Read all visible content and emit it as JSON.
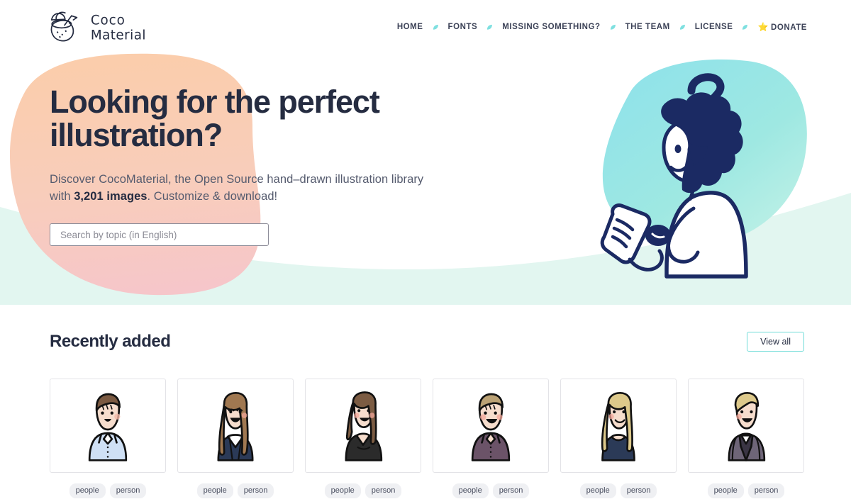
{
  "brand": {
    "name": "Coco Material",
    "line1": "Coco",
    "line2": "Material",
    "logo_icon": "coconut-drink-icon"
  },
  "nav": {
    "separator_icon": "leaf-dot-separator-icon",
    "items": [
      {
        "label": "HOME",
        "name": "nav-home"
      },
      {
        "label": "FONTS",
        "name": "nav-fonts"
      },
      {
        "label": "MISSING SOMETHING?",
        "name": "nav-missing-something"
      },
      {
        "label": "THE TEAM",
        "name": "nav-the-team"
      },
      {
        "label": "LICENSE",
        "name": "nav-license"
      },
      {
        "label": "DONATE",
        "name": "nav-donate",
        "icon": "star-icon",
        "icon_glyph": "⭐"
      }
    ]
  },
  "hero": {
    "title_line1": "Looking for the perfect",
    "title_line2": "illustration?",
    "subtitle_before": "Discover CocoMaterial, the Open Source hand–drawn illustration library with ",
    "subtitle_strong": "3,201 images",
    "subtitle_after": ". Customize & download!",
    "image_count": "3,201",
    "illustration_name": "person-with-phone-question-mark-illustration",
    "search": {
      "placeholder": "Search by topic (in English)",
      "value": ""
    }
  },
  "section": {
    "title": "Recently added",
    "view_all_label": "View all"
  },
  "cards": [
    {
      "name": "illustration-card-1",
      "alt": "man-brown-hair-light-blue-shirt",
      "tags": [
        "people",
        "person"
      ]
    },
    {
      "name": "illustration-card-2",
      "alt": "woman-long-brown-hair-navy-blazer",
      "tags": [
        "people",
        "person"
      ]
    },
    {
      "name": "illustration-card-3",
      "alt": "woman-wavy-brown-hair-black-cardigan",
      "tags": [
        "people",
        "person"
      ]
    },
    {
      "name": "illustration-card-4",
      "alt": "man-blond-hair-purple-shirt",
      "tags": [
        "people",
        "person"
      ]
    },
    {
      "name": "illustration-card-5",
      "alt": "woman-blonde-hair-navy-top",
      "tags": [
        "people",
        "person"
      ]
    },
    {
      "name": "illustration-card-6",
      "alt": "person-blond-hair-grey-blazer",
      "tags": [
        "people",
        "person"
      ]
    }
  ],
  "colors": {
    "ink": "#252c41",
    "muted_text": "#555b6e",
    "accent_teal": "#6fdcd8",
    "blob_peach_top": "#fbcdab",
    "blob_pink_bottom": "#f6c9cc",
    "wave_mint": "#e2f6f0",
    "hero_blob_cyan": "#9ae6e8",
    "tag_bg": "#eff0f3",
    "card_border": "#e3e3e7"
  }
}
